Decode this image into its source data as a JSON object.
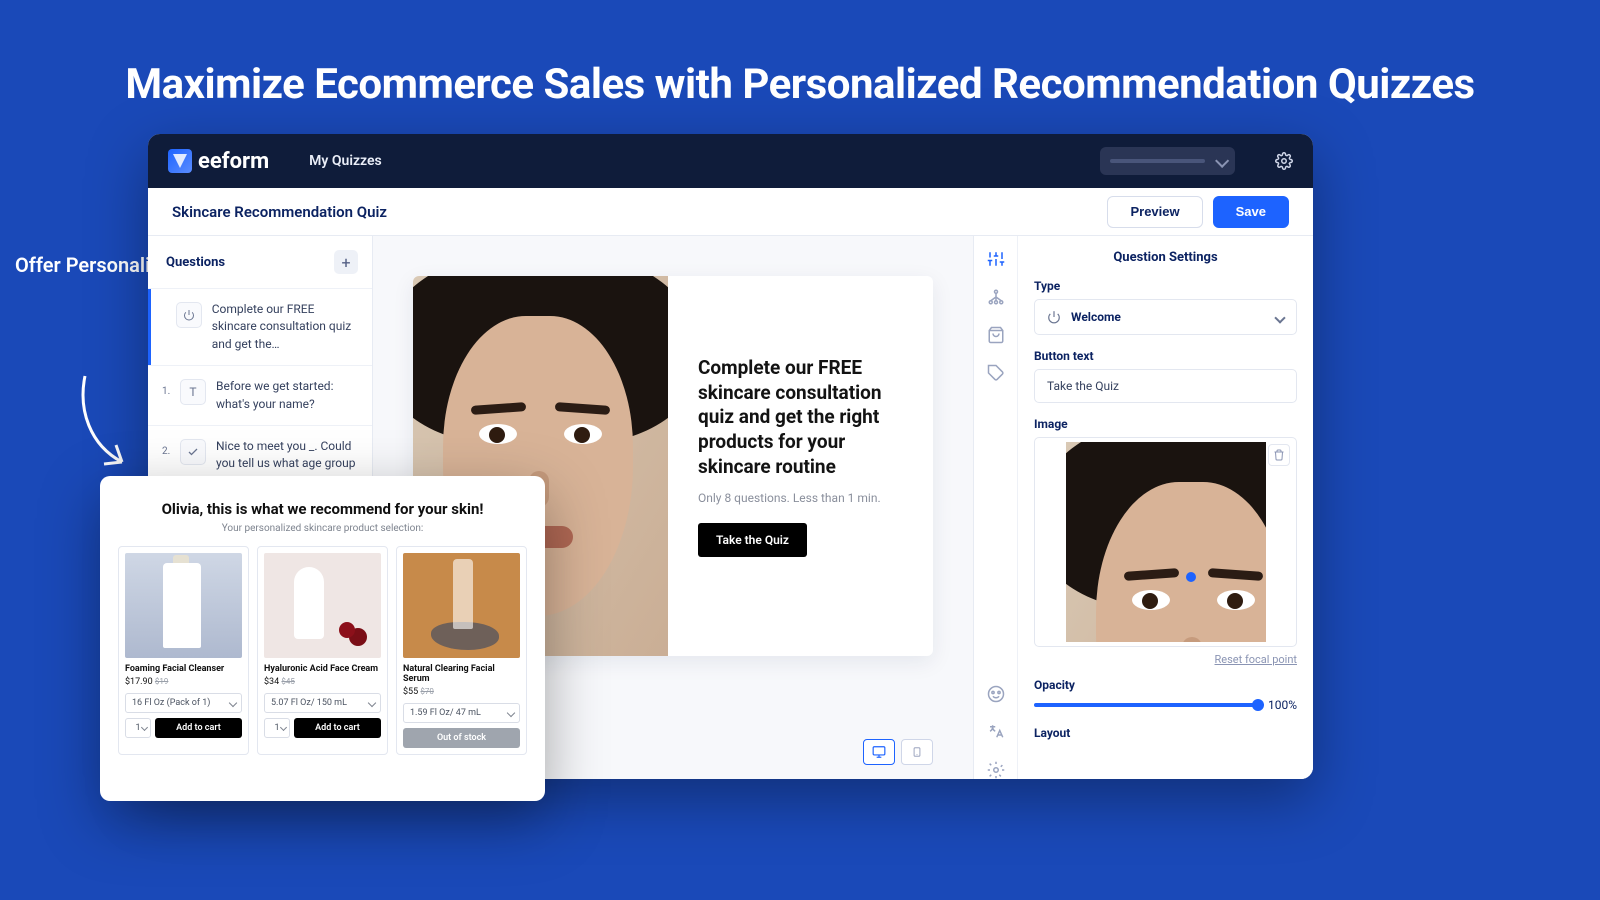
{
  "hero": "Maximize Ecommerce Sales with Personalized Recommendation Quizzes",
  "callout": "Offer Personalized Shopping Options",
  "brand": "eeform",
  "topnav": {
    "my_quizzes": "My Quizzes"
  },
  "subbar": {
    "title": "Skincare Recommendation Quiz",
    "preview": "Preview",
    "save": "Save"
  },
  "left": {
    "header": "Questions",
    "items": [
      {
        "idx": "",
        "icon": "power",
        "text": "Complete our FREE skincare consultation quiz and get the…"
      },
      {
        "idx": "1.",
        "icon": "T",
        "text": "Before we get started: what's your name?"
      },
      {
        "idx": "2.",
        "icon": "check",
        "text": "Nice to meet you _. Could you tell us what age group are you…"
      }
    ]
  },
  "stage": {
    "heading": "Complete our FREE skincare consultation quiz and get the right products for your skincare routine",
    "sub": "Only 8 questions. Less than 1 min.",
    "cta": "Take the Quiz"
  },
  "right": {
    "title": "Question Settings",
    "type_label": "Type",
    "type_value": "Welcome",
    "button_text_label": "Button text",
    "button_text_value": "Take the Quiz",
    "image_label": "Image",
    "reset": "Reset focal point",
    "opacity_label": "Opacity",
    "opacity_value": "100%",
    "layout_label": "Layout"
  },
  "popup": {
    "title": "Olivia, this is what we recommend for your skin!",
    "sub": "Your personalized skincare product selection:",
    "products": [
      {
        "name": "Foaming Facial Cleanser",
        "price": "$17.90",
        "old": "$19",
        "variant": "16 Fl Oz (Pack of 1)",
        "qty": "1",
        "cta": "Add to cart"
      },
      {
        "name": "Hyaluronic Acid Face Cream",
        "price": "$34",
        "old": "$45",
        "variant": "5.07 Fl Oz/ 150 mL",
        "qty": "1",
        "cta": "Add to cart"
      },
      {
        "name": "Natural Clearing Facial Serum",
        "price": "$55",
        "old": "$70",
        "variant": "1.59 Fl Oz/ 47 mL",
        "qty": "",
        "cta": "Out of stock"
      }
    ]
  }
}
